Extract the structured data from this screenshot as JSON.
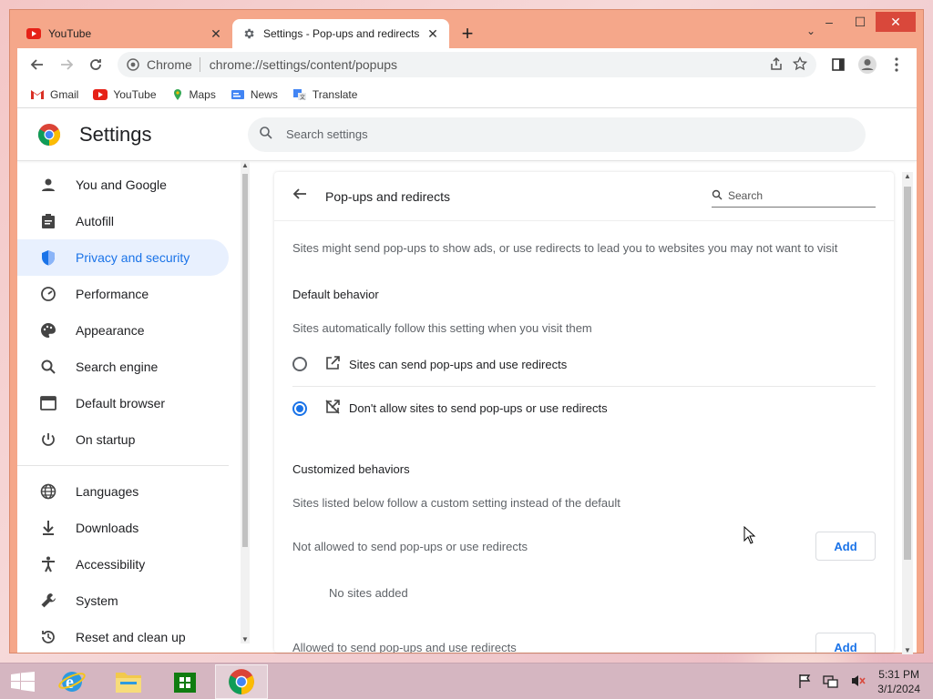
{
  "window": {
    "minimize": "–",
    "maximize": "☐",
    "close": "✕"
  },
  "tabs": [
    {
      "title": "YouTube",
      "active": false,
      "icon": "youtube-icon"
    },
    {
      "title": "Settings - Pop-ups and redirects",
      "active": true,
      "icon": "gear-icon"
    }
  ],
  "toolbar": {
    "site_label": "Chrome",
    "url": "chrome://settings/content/popups"
  },
  "bookmarks": [
    "Gmail",
    "YouTube",
    "Maps",
    "News",
    "Translate"
  ],
  "settings": {
    "title": "Settings",
    "search_placeholder": "Search settings"
  },
  "sidebar": {
    "items": [
      {
        "label": "You and Google",
        "icon": "person-icon"
      },
      {
        "label": "Autofill",
        "icon": "clipboard-icon"
      },
      {
        "label": "Privacy and security",
        "icon": "shield-icon",
        "active": true
      },
      {
        "label": "Performance",
        "icon": "gauge-icon"
      },
      {
        "label": "Appearance",
        "icon": "palette-icon"
      },
      {
        "label": "Search engine",
        "icon": "search-icon"
      },
      {
        "label": "Default browser",
        "icon": "browser-icon"
      },
      {
        "label": "On startup",
        "icon": "power-icon"
      }
    ],
    "items2": [
      {
        "label": "Languages",
        "icon": "globe-icon"
      },
      {
        "label": "Downloads",
        "icon": "download-icon"
      },
      {
        "label": "Accessibility",
        "icon": "accessibility-icon"
      },
      {
        "label": "System",
        "icon": "wrench-icon"
      },
      {
        "label": "Reset and clean up",
        "icon": "history-icon"
      }
    ]
  },
  "panel": {
    "title": "Pop-ups and redirects",
    "search_placeholder": "Search",
    "description": "Sites might send pop-ups to show ads, or use redirects to lead you to websites you may not want to visit",
    "default_behavior_title": "Default behavior",
    "default_behavior_desc": "Sites automatically follow this setting when you visit them",
    "option_allow": "Sites can send pop-ups and use redirects",
    "option_block": "Don't allow sites to send pop-ups or use redirects",
    "customized_title": "Customized behaviors",
    "customized_desc": "Sites listed below follow a custom setting instead of the default",
    "not_allowed_label": "Not allowed to send pop-ups or use redirects",
    "add_label": "Add",
    "no_sites": "No sites added",
    "allowed_label": "Allowed to send pop-ups and use redirects"
  },
  "taskbar": {
    "time": "5:31 PM",
    "date": "3/1/2024"
  },
  "colors": {
    "accent": "#1a73e8",
    "window_frame": "#f5a78a",
    "active_nav_bg": "#e8f0fe"
  }
}
